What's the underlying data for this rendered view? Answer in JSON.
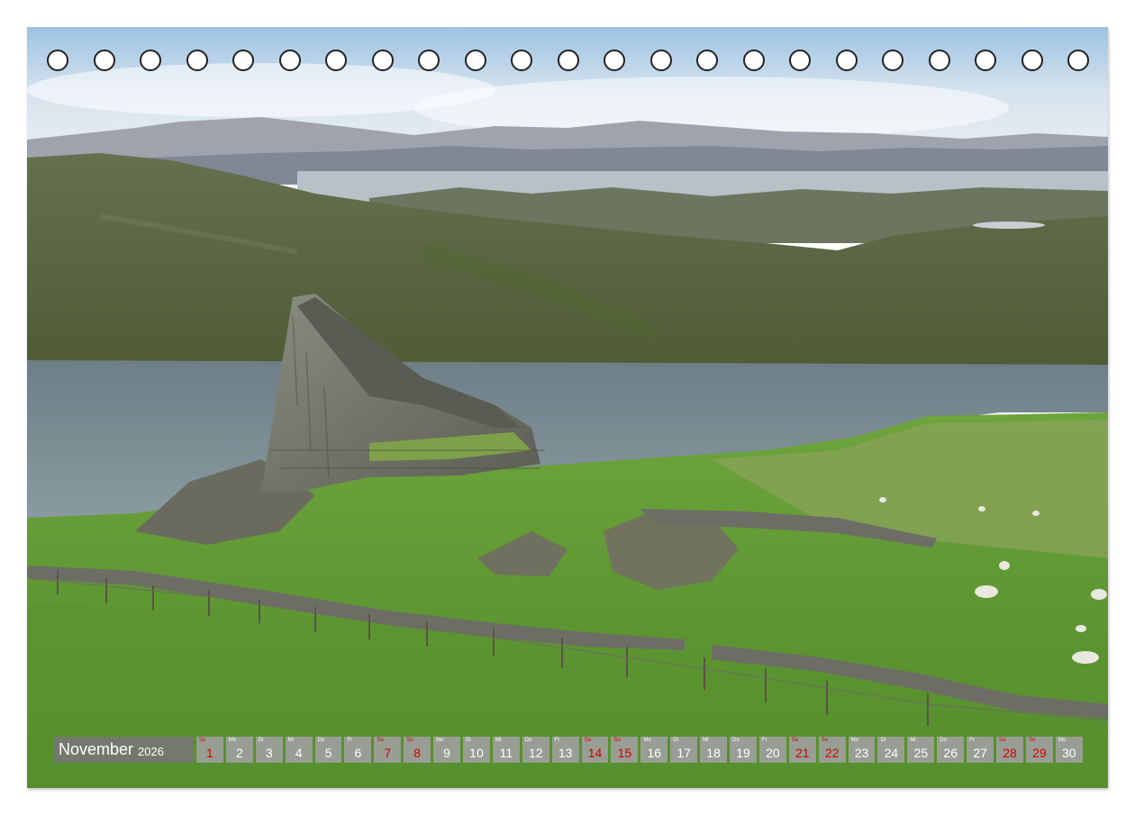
{
  "calendar": {
    "month": "November",
    "year": "2026",
    "days": [
      {
        "n": "1",
        "wd": "So",
        "weekend": true
      },
      {
        "n": "2",
        "wd": "Mo",
        "weekend": false
      },
      {
        "n": "3",
        "wd": "Di",
        "weekend": false
      },
      {
        "n": "4",
        "wd": "Mi",
        "weekend": false
      },
      {
        "n": "5",
        "wd": "Do",
        "weekend": false
      },
      {
        "n": "6",
        "wd": "Fr",
        "weekend": false
      },
      {
        "n": "7",
        "wd": "Sa",
        "weekend": true
      },
      {
        "n": "8",
        "wd": "So",
        "weekend": true
      },
      {
        "n": "9",
        "wd": "Mo",
        "weekend": false
      },
      {
        "n": "10",
        "wd": "Di",
        "weekend": false
      },
      {
        "n": "11",
        "wd": "Mi",
        "weekend": false
      },
      {
        "n": "12",
        "wd": "Do",
        "weekend": false
      },
      {
        "n": "13",
        "wd": "Fr",
        "weekend": false
      },
      {
        "n": "14",
        "wd": "Sa",
        "weekend": true
      },
      {
        "n": "15",
        "wd": "So",
        "weekend": true
      },
      {
        "n": "16",
        "wd": "Mo",
        "weekend": false
      },
      {
        "n": "17",
        "wd": "Di",
        "weekend": false
      },
      {
        "n": "18",
        "wd": "Mi",
        "weekend": false
      },
      {
        "n": "19",
        "wd": "Do",
        "weekend": false
      },
      {
        "n": "20",
        "wd": "Fr",
        "weekend": false
      },
      {
        "n": "21",
        "wd": "Sa",
        "weekend": true
      },
      {
        "n": "22",
        "wd": "So",
        "weekend": true
      },
      {
        "n": "23",
        "wd": "Mo",
        "weekend": false
      },
      {
        "n": "24",
        "wd": "Di",
        "weekend": false
      },
      {
        "n": "25",
        "wd": "Mi",
        "weekend": false
      },
      {
        "n": "26",
        "wd": "Do",
        "weekend": false
      },
      {
        "n": "27",
        "wd": "Fr",
        "weekend": false
      },
      {
        "n": "28",
        "wd": "Sa",
        "weekend": true
      },
      {
        "n": "29",
        "wd": "So",
        "weekend": true
      },
      {
        "n": "30",
        "wd": "Mo",
        "weekend": false
      }
    ]
  },
  "colors": {
    "weekend": "#d10000",
    "day_bg": "#a0a0a0",
    "month_bg": "#767676"
  }
}
